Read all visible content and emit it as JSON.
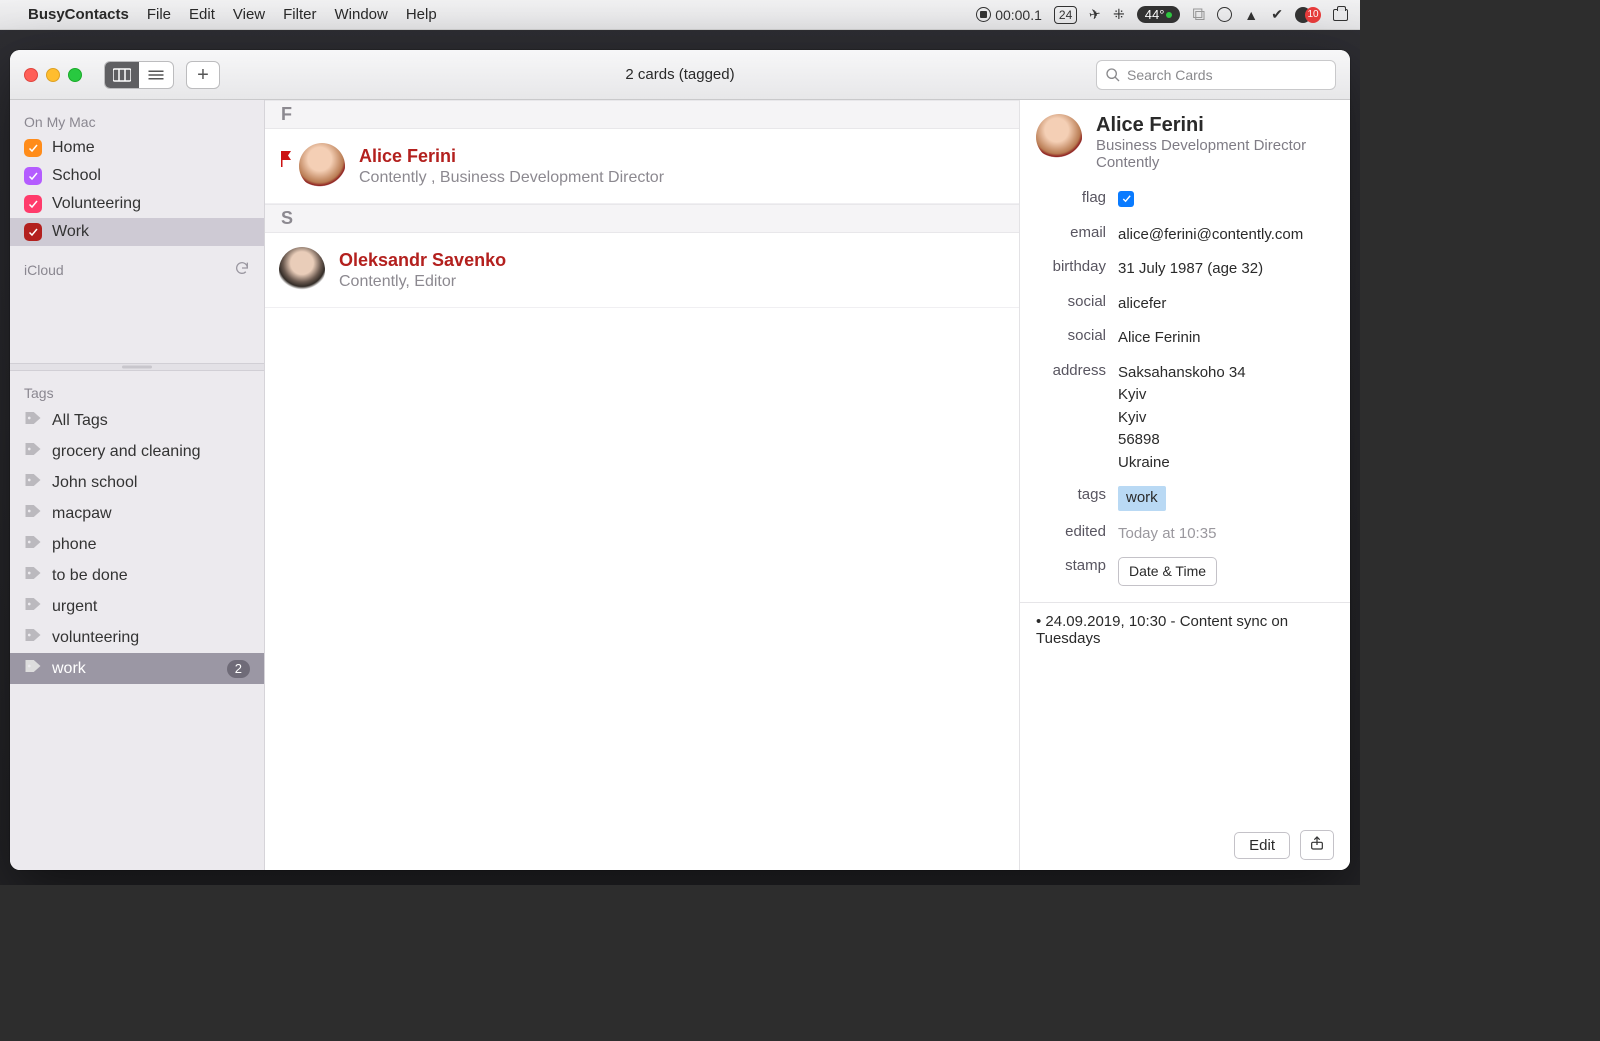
{
  "menubar": {
    "app_name": "BusyContacts",
    "items": [
      "File",
      "Edit",
      "View",
      "Filter",
      "Window",
      "Help"
    ],
    "status_time": "00:00.1",
    "status_date": "24",
    "status_pill": "44°",
    "status_notif": "10"
  },
  "toolbar": {
    "title": "2 cards (tagged)",
    "add_tooltip": "+",
    "search_placeholder": "Search Cards"
  },
  "sidebar": {
    "group1_heading": "On My Mac",
    "group1_items": [
      {
        "label": "Home",
        "color": "#ff8c1a",
        "checked": true,
        "selected": false
      },
      {
        "label": "School",
        "color": "#b45cff",
        "checked": true,
        "selected": false
      },
      {
        "label": "Volunteering",
        "color": "#ff3b6b",
        "checked": true,
        "selected": false
      },
      {
        "label": "Work",
        "color": "#b3201e",
        "checked": true,
        "selected": true
      }
    ],
    "group2_heading": "iCloud",
    "group3_heading": "Tags",
    "group3_items": [
      {
        "label": "All Tags"
      },
      {
        "label": "grocery and cleaning"
      },
      {
        "label": "John school"
      },
      {
        "label": "macpaw"
      },
      {
        "label": "phone"
      },
      {
        "label": "to be done"
      },
      {
        "label": "urgent"
      },
      {
        "label": "volunteering"
      },
      {
        "label": "work",
        "count": "2",
        "selected": true
      }
    ]
  },
  "list": {
    "sections": [
      {
        "letter": "F",
        "cards": [
          {
            "name": "Alice Ferini",
            "sub": "Contently , Business Development Director",
            "flagged": true,
            "avatar": "f1"
          }
        ]
      },
      {
        "letter": "S",
        "cards": [
          {
            "name": "Oleksandr Savenko",
            "sub": "Contently, Editor",
            "flagged": false,
            "avatar": "f2"
          }
        ]
      }
    ]
  },
  "detail": {
    "name": "Alice Ferini",
    "title": "Business Development Director",
    "company": "Contently",
    "fields": {
      "flag_label": "flag",
      "flag_checked": true,
      "email_label": "email",
      "email_value": "alice@ferini@contently.com",
      "birthday_label": "birthday",
      "birthday_value": "31 July 1987 (age 32)",
      "social1_label": "social",
      "social1_value": "alicefer",
      "social2_label": "social",
      "social2_value": "Alice Ferinin",
      "address_label": "address",
      "address_value": "Saksahanskoho 34\nKyiv\nKyiv\n56898\nUkraine",
      "tags_label": "tags",
      "tags_value": "work",
      "edited_label": "edited",
      "edited_value": "Today at 10:35",
      "stamp_label": "stamp",
      "stamp_button": "Date & Time"
    },
    "note": "• 24.09.2019, 10:30 - Content sync on Tuesdays",
    "edit_button": "Edit"
  }
}
